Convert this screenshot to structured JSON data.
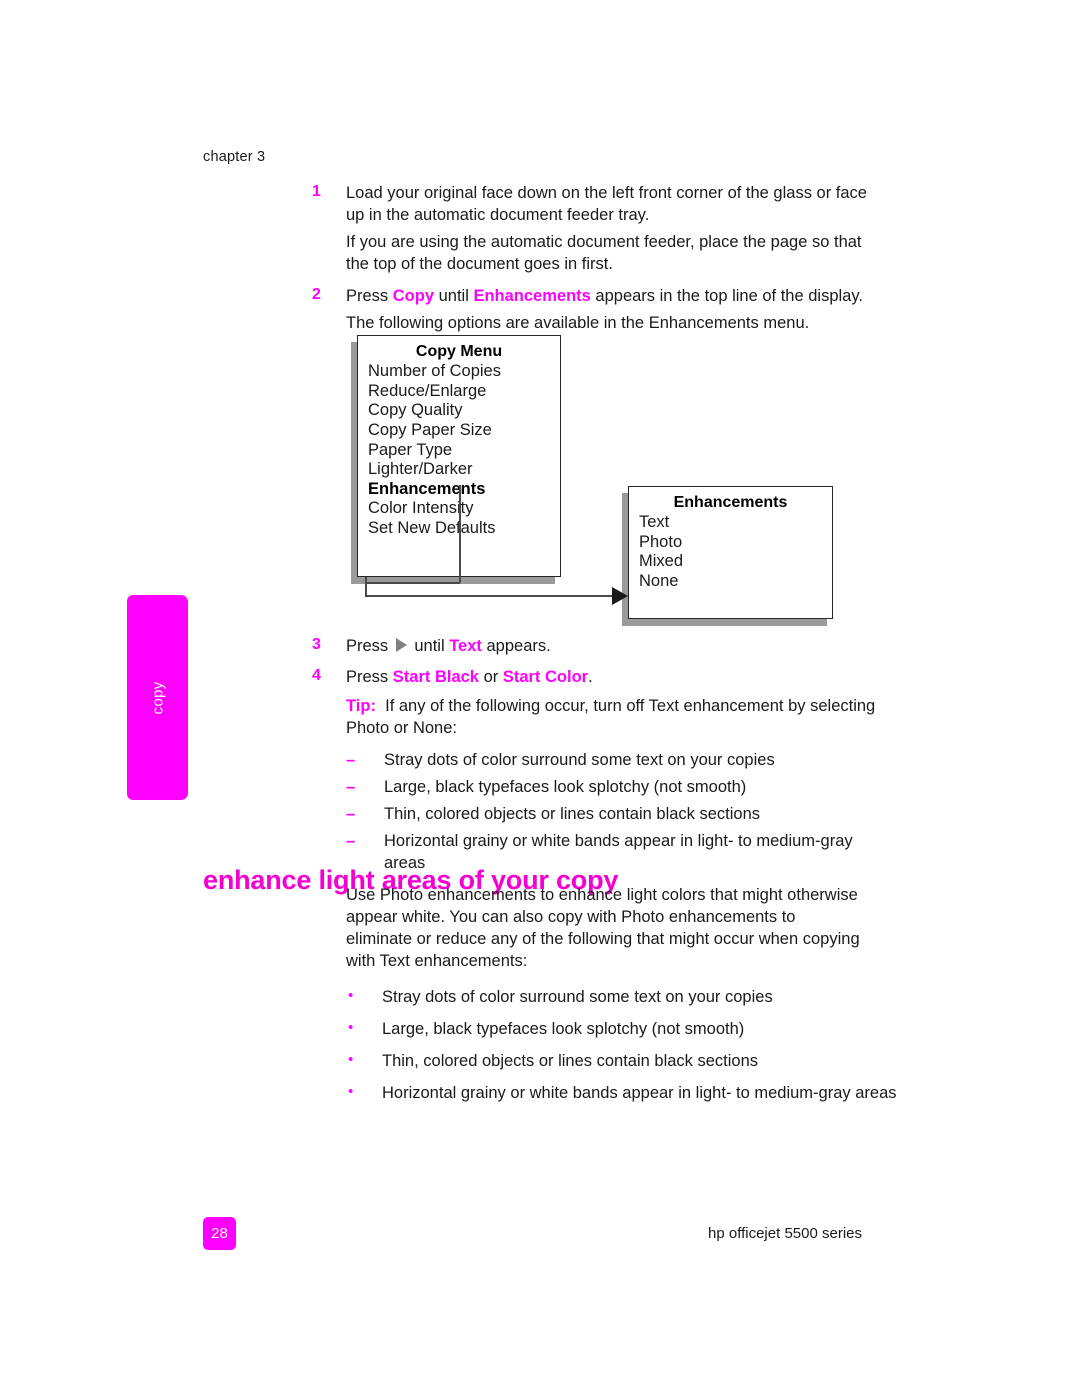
{
  "document": {
    "chapter_label": "chapter 3",
    "page_number": "28",
    "product_footer": "hp officejet 5500 series",
    "side_tab_label": "copy",
    "accent_color": "#ff00ff",
    "heading_color": "#f500d2"
  },
  "steps": [
    {
      "number": "1",
      "text": "Load your original face down on the left front corner of the glass or face up in the automatic document feeder tray.",
      "continuation": "If you are using the automatic document feeder, place the page so that the top of the document goes in first."
    },
    {
      "number": "2",
      "text_before": "Press ",
      "keyword_1": "Copy",
      "text_middle": " until ",
      "keyword_2": "Enhancements",
      "text_after": " appears in the top line of the display.",
      "continuation": "The following options are available in the Enhancements menu."
    }
  ],
  "diagram": {
    "copy_menu": {
      "title": "Copy Menu",
      "items": [
        "Number of Copies",
        "Reduce/Enlarge",
        "Copy Quality",
        "Copy Paper Size",
        "Paper Type",
        "Lighter/Darker",
        "Enhancements",
        "Color Intensity",
        "Set New Defaults"
      ],
      "highlighted_item": "Enhancements"
    },
    "enhancements_menu": {
      "title": "Enhancements",
      "items": [
        "Text",
        "Photo",
        "Mixed",
        "None"
      ]
    }
  },
  "steps2": [
    {
      "number": "3",
      "text_before": "Press ",
      "icon": "right-arrow-icon",
      "text_middle": " until ",
      "keyword_1": "Text",
      "text_after": " appears."
    },
    {
      "number": "4",
      "text_before": "Press ",
      "keyword_1": "Start Black",
      "text_middle": " or ",
      "keyword_2": "Start Color",
      "text_after": "."
    }
  ],
  "tip": {
    "label": "Tip:",
    "text": "If any of the following occur, turn off Text enhancement by selecting Photo or None:",
    "items": [
      "Stray dots of color surround some text on your copies",
      "Large, black typefaces look splotchy (not smooth)",
      "Thin, colored objects or lines contain black sections",
      "Horizontal grainy or white bands appear in light- to medium-gray areas"
    ]
  },
  "section": {
    "heading": "enhance light areas of your copy",
    "paragraph": "Use Photo enhancements to enhance light colors that might otherwise appear white. You can also copy with Photo enhancements to eliminate or reduce any of the following that might occur when copying with Text enhancements:",
    "bullets": [
      "Stray dots of color surround some text on your copies",
      "Large, black typefaces look splotchy (not smooth)",
      "Thin, colored objects or lines contain black sections",
      "Horizontal grainy or white bands appear in light- to medium-gray areas"
    ]
  }
}
